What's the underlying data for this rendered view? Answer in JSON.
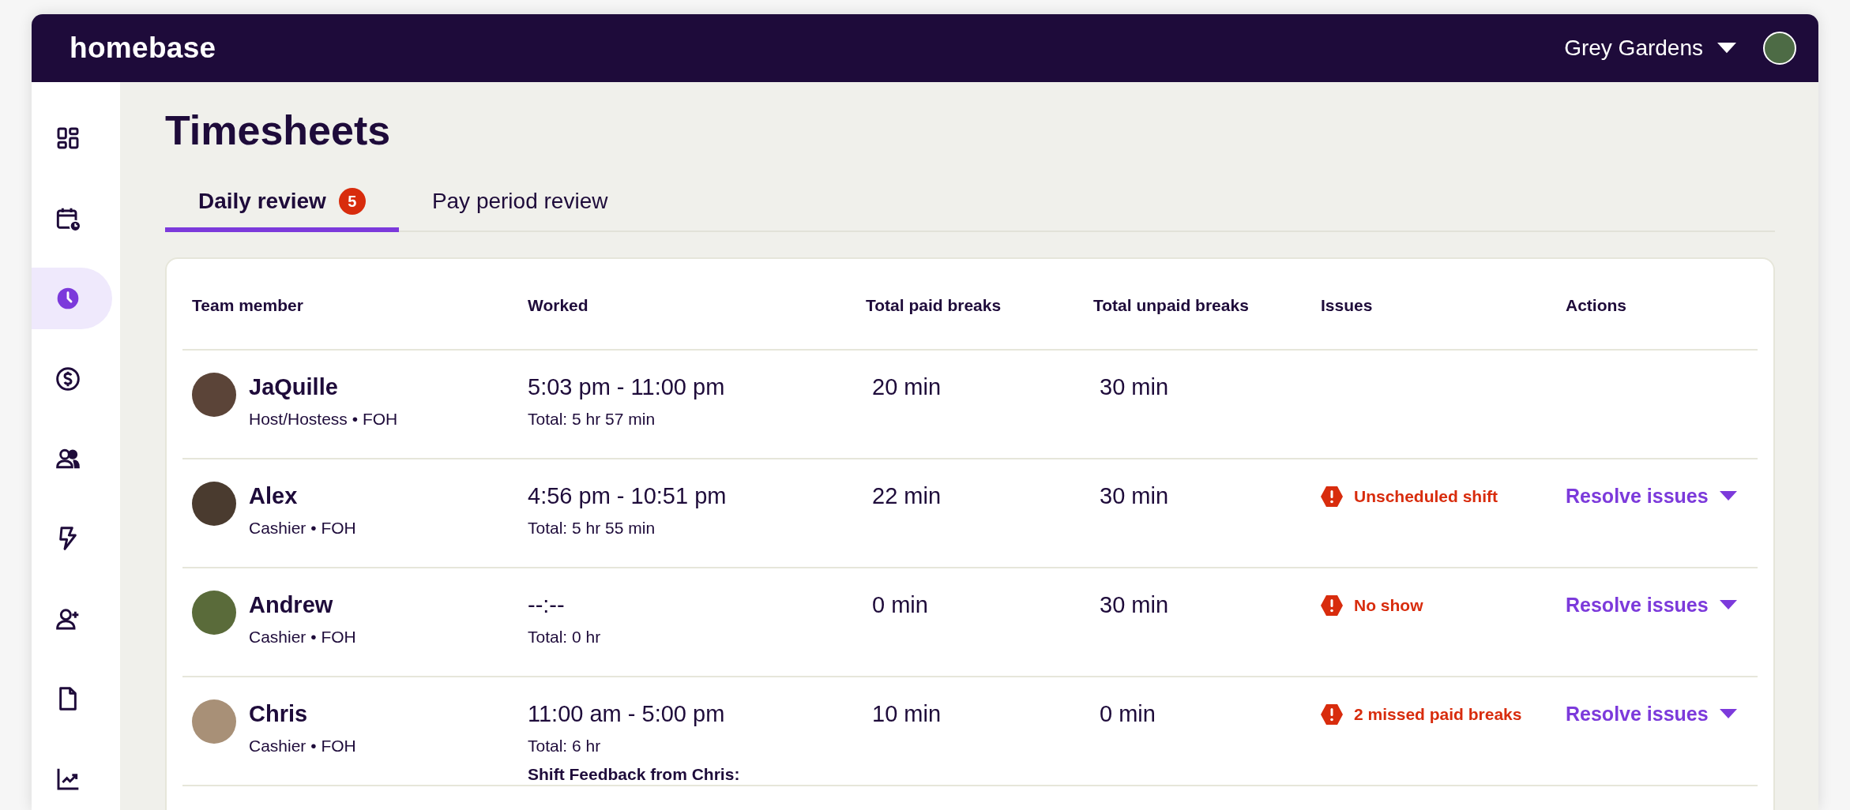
{
  "topbar": {
    "logo": "homebase",
    "location": "Grey Gardens"
  },
  "sidebar": {
    "items": [
      {
        "kind": "dashboard",
        "selected": false
      },
      {
        "kind": "schedule",
        "selected": false
      },
      {
        "kind": "timesheets",
        "selected": true
      },
      {
        "kind": "payroll",
        "selected": false
      },
      {
        "kind": "team",
        "selected": false
      },
      {
        "kind": "automation",
        "selected": false
      },
      {
        "kind": "hiring",
        "selected": false
      },
      {
        "kind": "documents",
        "selected": false
      },
      {
        "kind": "reports",
        "selected": false
      }
    ]
  },
  "page": {
    "title": "Timesheets"
  },
  "tabs": [
    {
      "label": "Daily review",
      "badge": "5",
      "selected": true
    },
    {
      "label": "Pay period review",
      "selected": false
    }
  ],
  "table": {
    "columns": [
      "Team member",
      "Worked",
      "Total paid breaks",
      "Total unpaid breaks",
      "Issues",
      "Actions"
    ],
    "rows": [
      {
        "name": "JaQuille",
        "role": "Host/Hostess • FOH",
        "worked": "5:03 pm - 11:00 pm",
        "total": "Total: 5 hr 57 min",
        "paid_breaks": "20 min",
        "unpaid_breaks": "30 min"
      },
      {
        "name": "Alex",
        "role": "Cashier • FOH",
        "worked": "4:56 pm - 10:51 pm",
        "total": "Total: 5 hr 55 min",
        "paid_breaks": "22 min",
        "unpaid_breaks": "30 min",
        "issue": "Unscheduled shift",
        "action": "Resolve issues"
      },
      {
        "name": "Andrew",
        "role": "Cashier • FOH",
        "worked": "--:--",
        "total": "Total: 0 hr",
        "paid_breaks": "0 min",
        "unpaid_breaks": "30 min",
        "issue": "No show",
        "action": "Resolve issues"
      },
      {
        "name": "Chris",
        "role": "Cashier • FOH",
        "worked": "11:00 am - 5:00 pm",
        "total": "Total: 6 hr",
        "feedback": "Shift Feedback from Chris:",
        "paid_breaks": "10 min",
        "unpaid_breaks": "0 min",
        "issue": "2 missed paid breaks",
        "action": "Resolve issues"
      }
    ]
  }
}
